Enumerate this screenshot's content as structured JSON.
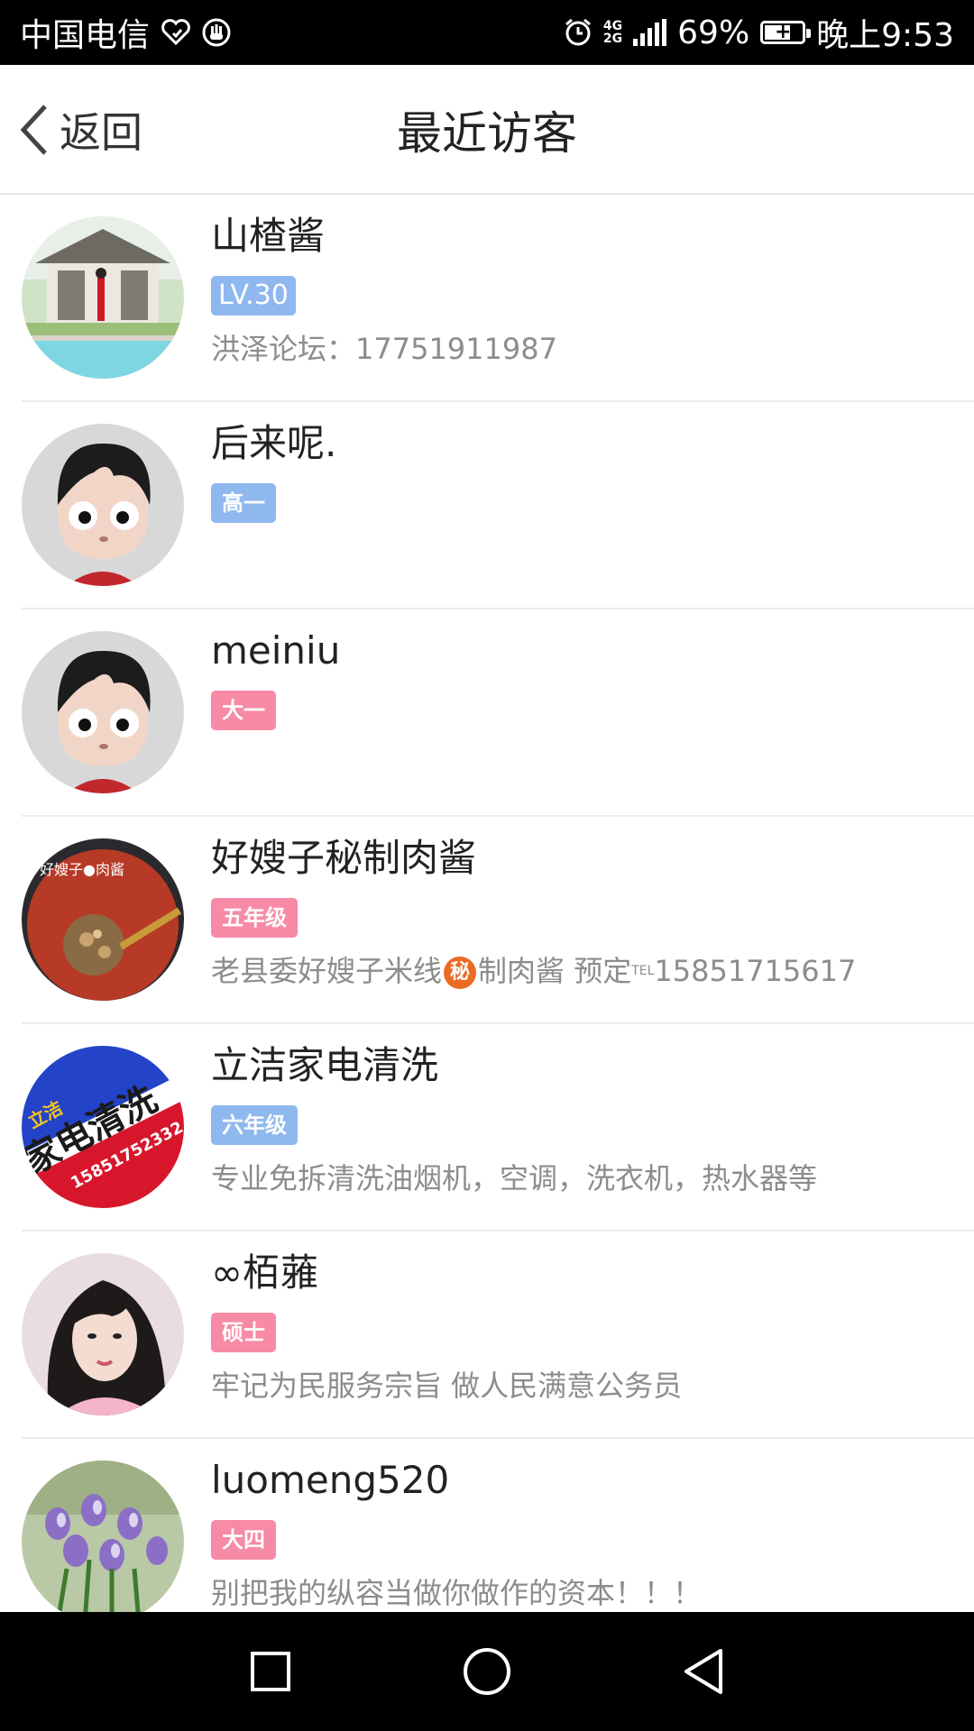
{
  "status_bar": {
    "carrier": "中国电信",
    "network_top": "4G",
    "network_bottom": "2G",
    "battery_percent": "69%",
    "battery_level": 0.69,
    "time": "晚上9:53"
  },
  "header": {
    "back_label": "返回",
    "title": "最近访客"
  },
  "visitors": [
    {
      "name": "山楂酱",
      "badge": "LV.30",
      "badge_color": "#8fb8ee",
      "desc": "洪泽论坛：17751911987",
      "avatar": "pavilion-photo"
    },
    {
      "name": "后来呢.",
      "badge": "高一",
      "badge_color": "#8fb8ee",
      "desc": "",
      "avatar": "cartoon-default-avatar"
    },
    {
      "name": "meiniu",
      "badge": "大一",
      "badge_color": "#f78aa5",
      "desc": "",
      "avatar": "cartoon-default-avatar"
    },
    {
      "name": "好嫂子秘制肉酱",
      "badge": "五年级",
      "badge_color": "#f78aa5",
      "desc_before": "老县委好嫂子米线",
      "desc_secret": "秘",
      "desc_after": "制肉酱 预定",
      "desc_tel": "TEL",
      "desc_phone": "15851715617",
      "avatar": "meat-sauce-photo",
      "avatar_text": "好嫂子●肉酱"
    },
    {
      "name": "立洁家电清洗",
      "badge": "六年级",
      "badge_color": "#8fb8ee",
      "desc": "专业免拆清洗油烟机，空调，洗衣机，热水器等",
      "avatar": "appliance-cleaning-logo",
      "avatar_text_1": "立洁",
      "avatar_text_2": "家电清洗",
      "avatar_text_3": "15851752332"
    },
    {
      "name": "∞栢蕥",
      "badge": "硕士",
      "badge_color": "#f78aa5",
      "desc": "牢记为民服务宗旨   做人民满意公务员",
      "avatar": "portrait-photo"
    },
    {
      "name": "luomeng520",
      "badge": "大四",
      "badge_color": "#f78aa5",
      "desc": "别把我的纵容当做你做作的资本！！！",
      "avatar": "flowers-photo"
    }
  ],
  "nav_bar": {
    "recents_icon": "square-icon",
    "home_icon": "circle-icon",
    "back_icon": "triangle-back-icon"
  }
}
